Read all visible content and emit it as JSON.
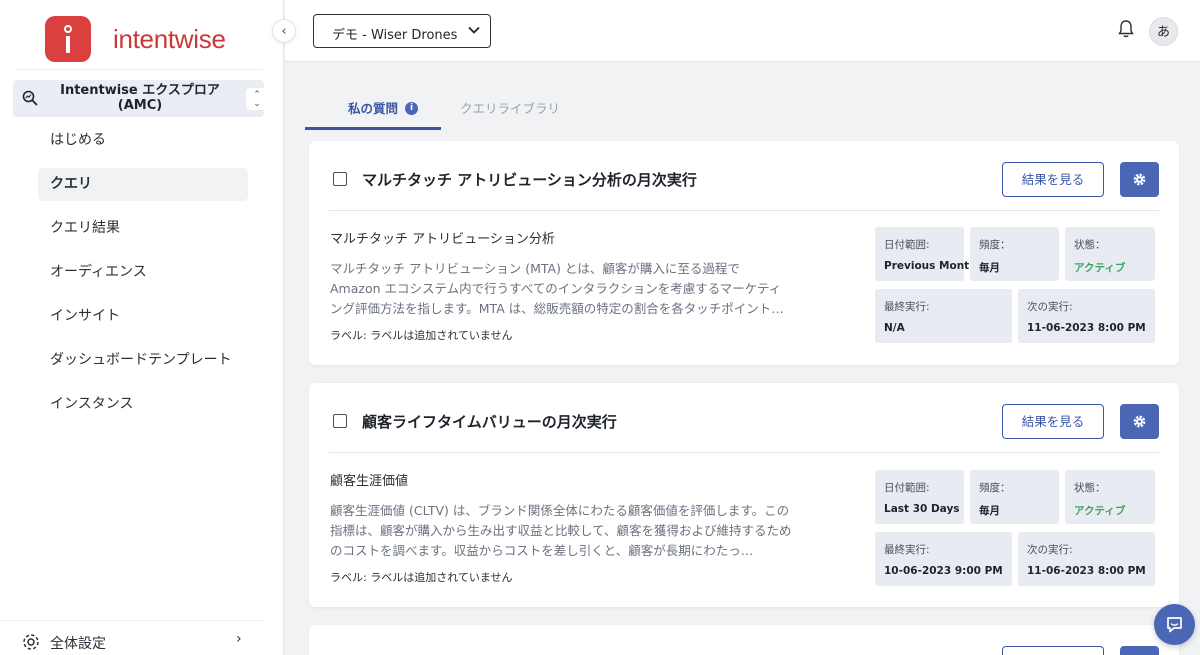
{
  "brand": {
    "name": "intentwise",
    "accent": "#d9403e"
  },
  "sidebar": {
    "product": {
      "title": "Intentwise エクスプロア (AMC)",
      "icon": "search-chart-icon"
    },
    "items": [
      {
        "label": "はじめる",
        "active": false
      },
      {
        "label": "クエリ",
        "active": true
      },
      {
        "label": "クエリ結果",
        "active": false
      },
      {
        "label": "オーディエンス",
        "active": false
      },
      {
        "label": "インサイト",
        "active": false
      },
      {
        "label": "ダッシュボードテンプレート",
        "active": false
      },
      {
        "label": "インスタンス",
        "active": false
      }
    ],
    "settings_label": "全体設定"
  },
  "header": {
    "account_selector": "デモ - Wiser Drones",
    "avatar_initial": "あ"
  },
  "tabs": [
    {
      "label": "私の質問",
      "active": true
    },
    {
      "label": "クエリライブラリ",
      "active": false
    }
  ],
  "queries": [
    {
      "title": "マルチタッチ アトリビューション分析の月次実行",
      "view_button": "結果を見る",
      "subtitle": "マルチタッチ アトリビューション分析",
      "description": "マルチタッチ アトリビューション (MTA) とは、顧客が購入に至る過程で Amazon エコシステム内で行うすべてのインタラクションを考慮するマーケティング評価方法を指します。MTA は、総販売額の特定の割合を各タッチポイント…",
      "labels": "ラベル: ラベルは追加されていません",
      "stats": {
        "date_range_key": "日付範囲:",
        "date_range_val": "Previous Month",
        "frequency_key": "頻度：",
        "frequency_val": "毎月",
        "status_key": "状態：",
        "status_val": "アクティブ",
        "last_run_key": "最終実行:",
        "last_run_val": "N/A",
        "next_run_key": "次の実行:",
        "next_run_val": "11-06-2023 8:00 PM"
      }
    },
    {
      "title": "顧客ライフタイムバリューの月次実行",
      "view_button": "結果を見る",
      "subtitle": "顧客生涯価値",
      "description": "顧客生涯価値 (CLTV) は、ブランド関係全体にわたる顧客価値を評価します。この指標は、顧客が購入から生み出す収益と比較して、顧客を獲得および維持するためのコストを調べます。収益からコストを差し引くと、顧客が長期にわたっ…",
      "labels": "ラベル: ラベルは追加されていません",
      "stats": {
        "date_range_key": "日付範囲:",
        "date_range_val": "Last 30 Days",
        "frequency_key": "頻度：",
        "frequency_val": "毎月",
        "status_key": "状態：",
        "status_val": "アクティブ",
        "last_run_key": "最終実行:",
        "last_run_val": "10-06-2023 9:00 PM",
        "next_run_key": "次の実行:",
        "next_run_val": "11-06-2023 8:00 PM"
      }
    }
  ],
  "colors": {
    "primary": "#4a66b5",
    "active_status": "#3ba55d"
  }
}
